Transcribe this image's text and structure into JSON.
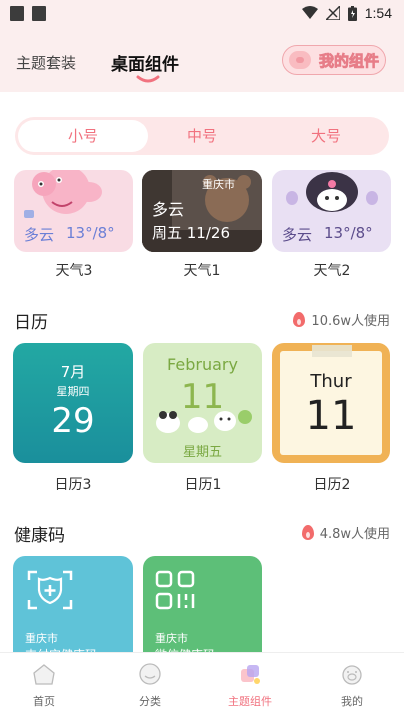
{
  "status_bar": {
    "time": "1:54"
  },
  "header": {
    "tabs": [
      {
        "label": "主题套装"
      },
      {
        "label": "桌面组件"
      }
    ],
    "my_widgets_label": "我的组件"
  },
  "size_tabs": [
    {
      "label": "小号"
    },
    {
      "label": "中号"
    },
    {
      "label": "大号"
    }
  ],
  "weather": {
    "cards": [
      {
        "label": "天气3",
        "condition": "多云",
        "temps": "13°/8°"
      },
      {
        "label": "天气1",
        "city": "重庆市",
        "condition": "多云",
        "date": "周五 11/26"
      },
      {
        "label": "天气2",
        "condition": "多云",
        "temps": "13°/8°"
      }
    ]
  },
  "calendar": {
    "title": "日历",
    "usage": "10.6w人使用",
    "cards": [
      {
        "label": "日历3",
        "month": "7月",
        "weekday": "星期四",
        "day": "29"
      },
      {
        "label": "日历1",
        "month": "February",
        "day": "11",
        "weekday": "星期五"
      },
      {
        "label": "日历2",
        "weekday": "Thur",
        "day": "11"
      }
    ]
  },
  "health": {
    "title": "健康码",
    "usage": "4.8w人使用",
    "cards": [
      {
        "city": "重庆市",
        "text": "支付宝健康码"
      },
      {
        "city": "重庆市",
        "text": "微信健康码"
      }
    ]
  },
  "bottom_nav": [
    {
      "label": "首页"
    },
    {
      "label": "分类"
    },
    {
      "label": "主题组件"
    },
    {
      "label": "我的"
    }
  ],
  "colors": {
    "accent": "#f1727f",
    "header_bg": "#fbeeee",
    "teal": "#1fa3a6",
    "health_blue": "#5fc3d8",
    "health_green": "#5dbf78"
  }
}
